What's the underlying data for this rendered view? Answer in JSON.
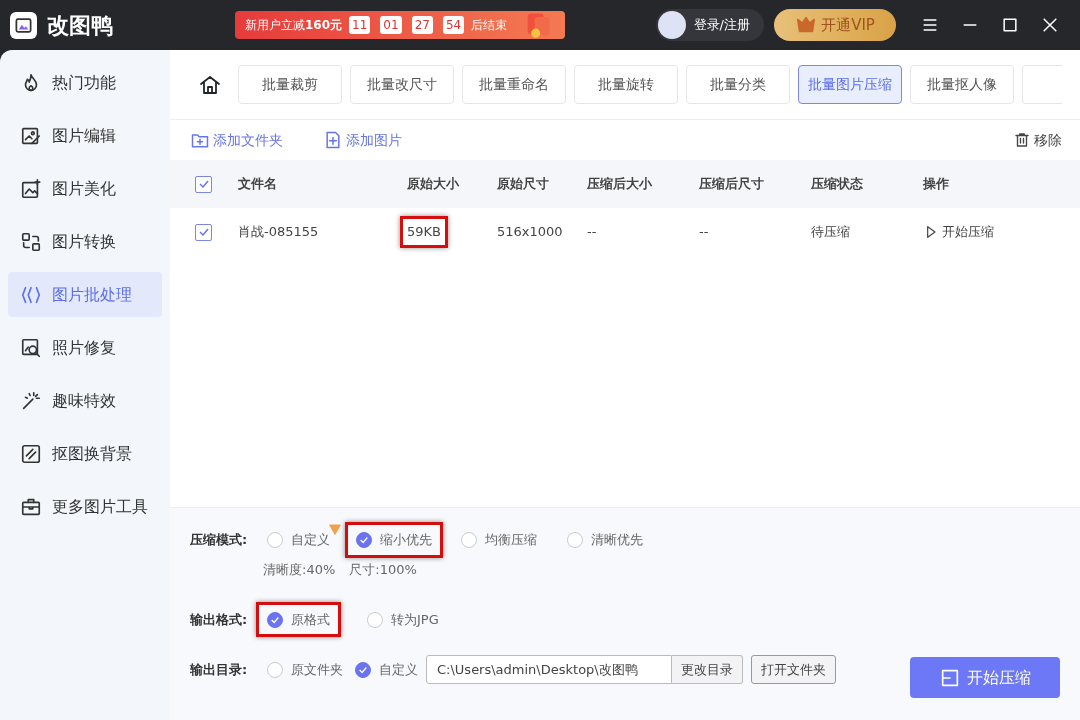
{
  "app": {
    "name": "改图鸭"
  },
  "promo": {
    "text": "新用户立减**160元**",
    "countdown": [
      "11",
      "01",
      "27",
      "54"
    ],
    "suffix": "后结束"
  },
  "user": {
    "login": "登录/注册"
  },
  "vip": {
    "label": "开通VIP"
  },
  "sidebar": {
    "items": [
      {
        "label": "热门功能",
        "selected": false
      },
      {
        "label": "图片编辑",
        "selected": false
      },
      {
        "label": "图片美化",
        "selected": false
      },
      {
        "label": "图片转换",
        "selected": false
      },
      {
        "label": "图片批处理",
        "selected": true
      },
      {
        "label": "照片修复",
        "selected": false
      },
      {
        "label": "趣味特效",
        "selected": false
      },
      {
        "label": "抠图换背景",
        "selected": false
      },
      {
        "label": "更多图片工具",
        "selected": false
      }
    ]
  },
  "tabs": [
    {
      "label": "批量裁剪",
      "selected": false
    },
    {
      "label": "批量改尺寸",
      "selected": false
    },
    {
      "label": "批量重命名",
      "selected": false
    },
    {
      "label": "批量旋转",
      "selected": false
    },
    {
      "label": "批量分类",
      "selected": false
    },
    {
      "label": "批量图片压缩",
      "selected": true
    },
    {
      "label": "批量抠人像",
      "selected": false
    }
  ],
  "actions": {
    "add_folder": "添加文件夹",
    "add_image": "添加图片",
    "remove": "移除"
  },
  "table": {
    "all_checked": true,
    "columns": [
      "文件名",
      "原始大小",
      "原始尺寸",
      "压缩后大小",
      "压缩后尺寸",
      "压缩状态",
      "操作"
    ],
    "rows": [
      {
        "checked": true,
        "cells": [
          {
            "text": "肖战-085155",
            "highlighted": false
          },
          {
            "text": "59KB",
            "highlighted": true
          },
          {
            "text": "516x1000",
            "highlighted": false
          },
          {
            "text": "--",
            "highlighted": false
          },
          {
            "text": "--",
            "highlighted": false
          },
          {
            "text": "待压缩",
            "highlighted": false
          }
        ],
        "action": "开始压缩"
      }
    ]
  },
  "compress_mode": {
    "label": "压缩模式:",
    "options": [
      {
        "label": "自定义",
        "selected": false,
        "vip": true,
        "highlighted": false
      },
      {
        "label": "缩小优先",
        "selected": true,
        "vip": false,
        "highlighted": true
      },
      {
        "label": "均衡压缩",
        "selected": false,
        "vip": false,
        "highlighted": false
      },
      {
        "label": "清晰优先",
        "selected": false,
        "vip": false,
        "highlighted": false
      }
    ],
    "info": [
      "清晰度:40%",
      "尺寸:100%"
    ]
  },
  "output_format": {
    "label": "输出格式:",
    "options": [
      {
        "label": "原格式",
        "selected": true,
        "highlighted": true
      },
      {
        "label": "转为JPG",
        "selected": false,
        "highlighted": false
      }
    ]
  },
  "output_dir": {
    "label": "输出目录:",
    "options": [
      {
        "label": "原文件夹",
        "selected": false
      },
      {
        "label": "自定义",
        "selected": true
      }
    ],
    "path": "C:\\Users\\admin\\Desktop\\改图鸭",
    "change": "更改目录",
    "open": "打开文件夹"
  },
  "start_button": "开始压缩"
}
